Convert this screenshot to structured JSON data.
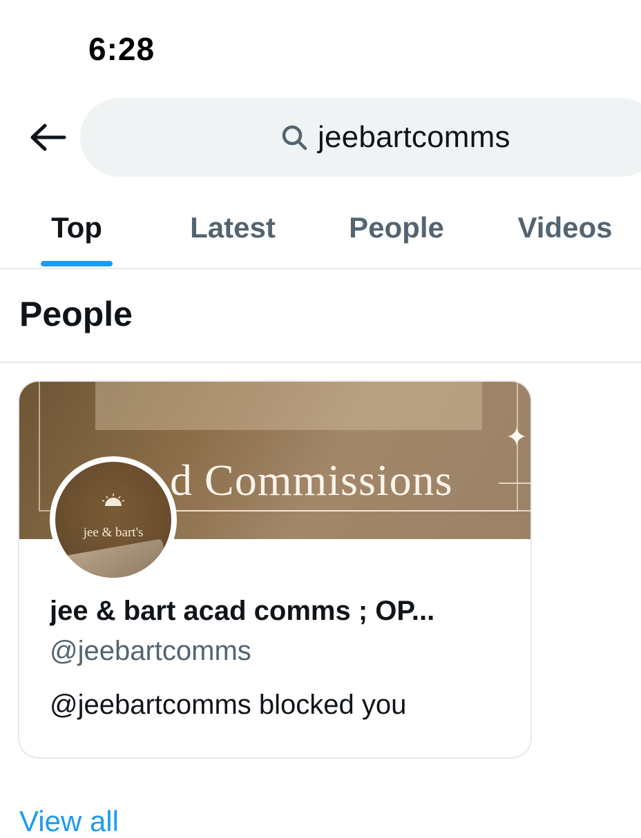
{
  "status_bar": {
    "time": "6:28"
  },
  "search": {
    "query": "jeebartcomms"
  },
  "tabs": [
    {
      "label": "Top",
      "active": true
    },
    {
      "label": "Latest",
      "active": false
    },
    {
      "label": "People",
      "active": false
    },
    {
      "label": "Videos",
      "active": false
    }
  ],
  "section": {
    "title": "People"
  },
  "user_card": {
    "banner_text": "d Commissions",
    "avatar_text": "jee & bart's",
    "display_name": "jee & bart acad comms ; OP...",
    "handle": "@jeebartcomms",
    "status": "@jeebartcomms blocked you"
  },
  "footer": {
    "view_all": "View all"
  },
  "colors": {
    "accent": "#1d9bf0",
    "text_primary": "#0f1419",
    "text_secondary": "#536471",
    "search_bg": "#eff3f4",
    "banner_brown": "#8c6f4a"
  }
}
